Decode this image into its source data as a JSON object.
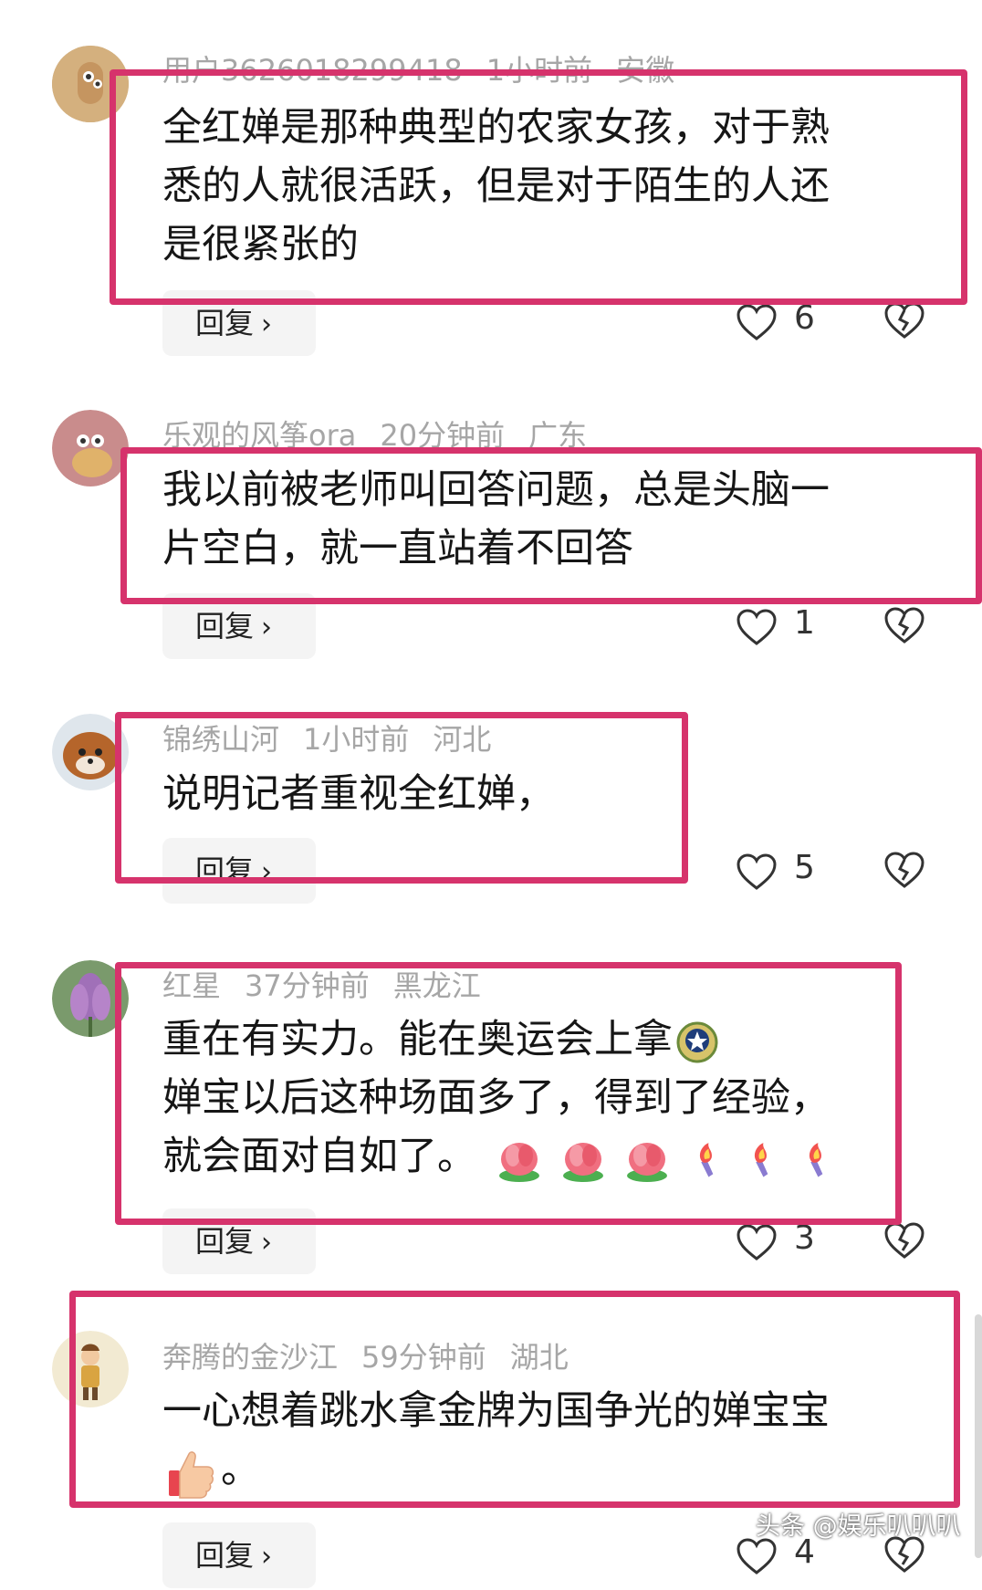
{
  "colors": {
    "highlight": "#d6336c",
    "meta": "#a6a6a6",
    "reply_bg": "#f4f4f4"
  },
  "comments": [
    {
      "user": "用户3626018299418",
      "time": "1小时前",
      "region": "安徽",
      "lines": [
        "全红婵是那种典型的农家女孩，对于熟",
        "悉的人就很活跃，但是对于陌生的人还",
        "是很紧张的"
      ],
      "reply": "回复",
      "likes": "6"
    },
    {
      "user": "乐观的风筝ora",
      "time": "20分钟前",
      "region": "广东",
      "lines": [
        "我以前被老师叫回答问题，总是头脑一",
        "片空白，就一直站着不回答"
      ],
      "reply": "回复",
      "likes": "1"
    },
    {
      "user": "锦绣山河",
      "time": "1小时前",
      "region": "河北",
      "lines": [
        "说明记者重视全红婵，"
      ],
      "reply": "回复",
      "likes": "5"
    },
    {
      "user": "红星",
      "time": "37分钟前",
      "region": "黑龙江",
      "lines": [
        "重在有实力。能在奥运会上拿",
        "婵宝以后这种场面多了，得到了经验，",
        "就会面对自如了。"
      ],
      "reply": "回复",
      "likes": "3"
    },
    {
      "user": "奔腾的金沙江",
      "time": "59分钟前",
      "region": "湖北",
      "lines": [
        "一心想着跳水拿金牌为国争光的婵宝宝",
        "。"
      ],
      "reply": "回复",
      "likes": "4"
    }
  ],
  "icons": {
    "like": "heart-outline-icon",
    "dislike": "broken-heart-icon",
    "chevron": "chevron-right-icon",
    "emoji_badge": "gold-medal-badge-icon",
    "emoji_rose": "rose-emoji-icon",
    "emoji_torch": "torch-emoji-icon",
    "emoji_thumb": "thumbs-up-emoji-icon"
  },
  "watermark": "头条 @娱乐叭叭叭"
}
